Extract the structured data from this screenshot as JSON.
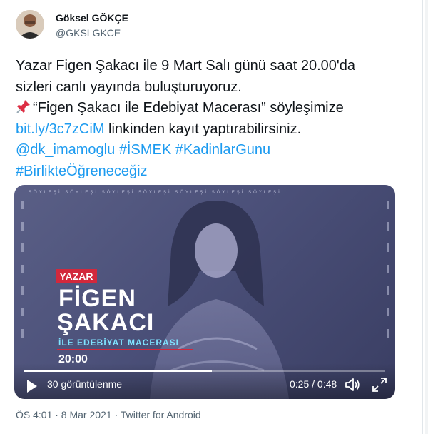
{
  "author": {
    "name": "Göksel GÖKÇE",
    "handle": "@GKSLGKCE"
  },
  "tweet": {
    "line1": "Yazar Figen Şakacı ile 9 Mart Salı günü saat 20.00'da",
    "line2": "sizleri canlı yayında buluşturuyoruz.",
    "line3_text": "“Figen Şakacı ile Edebiyat Macerası” söyleşimize",
    "line4_link": "bit.ly/3c7zCiM",
    "line4_text": " linkinden kayıt yaptırabilirsiniz.",
    "mention": "@dk_imamoglu",
    "hashtag1": "#İSMEK",
    "hashtag2": "#KadinlarGunu",
    "hashtag3": "#BirlikteÖğreneceğiz",
    "pin_icon": "pushpin-icon"
  },
  "video": {
    "strip_text": "SÖYLEŞİ  SÖYLEŞİ  SÖYLEŞİ  SÖYLEŞİ  SÖYLEŞİ  SÖYLEŞİ  SÖYLEŞİ",
    "badge": "YAZAR",
    "name_line1": "FİGEN",
    "name_line2": "ŞAKACI",
    "event_title": "İLE EDEBİYAT MACERASI",
    "event_time": "20:00",
    "views_label": "30 görüntülenme",
    "time_readout": "0:25 / 0:48",
    "progress_fraction": 0.52,
    "colors": {
      "badge": "#d2283c",
      "accent_text": "#7fe3ff",
      "bg": "#4b5079"
    }
  },
  "meta": {
    "timestamp": "ÖS 4:01 · 8 Mar 2021 · Twitter for Android"
  },
  "colors": {
    "link": "#1d9bf0",
    "secondary": "#536471",
    "text": "#0f1419"
  }
}
